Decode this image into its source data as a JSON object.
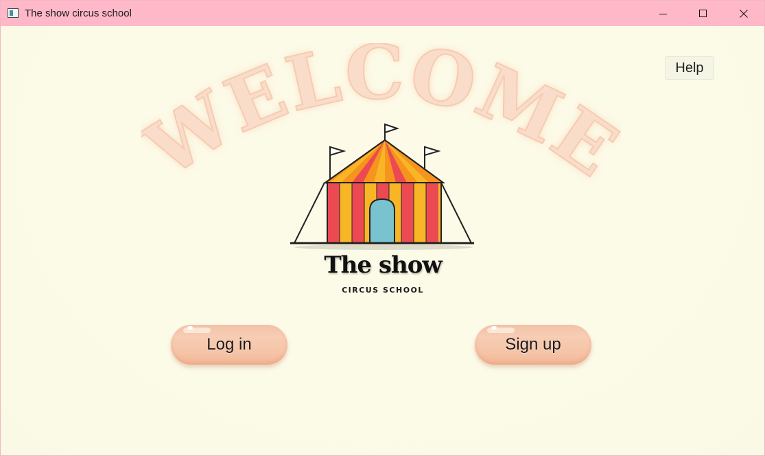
{
  "window": {
    "title": "The show circus school",
    "icon": "app-icon"
  },
  "controls": {
    "minimize_icon": "minimize-icon",
    "maximize_icon": "maximize-icon",
    "close_icon": "close-icon"
  },
  "welcome": {
    "text": "WELCOME",
    "color": "#f9d7c0"
  },
  "help": {
    "label": "Help"
  },
  "logo": {
    "name": "The show",
    "subtitle": "CIRCUS SCHOOL",
    "icon": "circus-tent-icon",
    "colors": {
      "red": "#ec4a52",
      "orange": "#f7941d",
      "yellow": "#f8b626",
      "door": "#79c2cf"
    }
  },
  "actions": {
    "login_label": "Log in",
    "signup_label": "Sign up",
    "button_color": "#f6c6ab"
  },
  "colors": {
    "titlebar": "#ffb8c8",
    "background": "#fbfbe9"
  }
}
